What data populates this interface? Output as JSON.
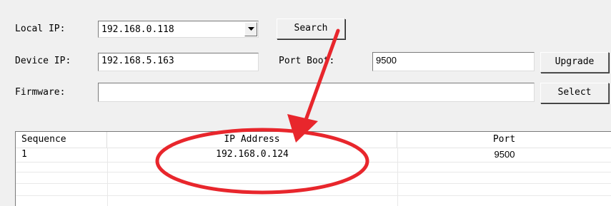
{
  "form": {
    "local_ip_label": "Local IP:",
    "local_ip_value": "192.168.0.118",
    "search_label": "Search",
    "device_ip_label": "Device IP:",
    "device_ip_value": "192.168.5.163",
    "port_boot_label": "Port Boot:",
    "port_boot_value": "9500",
    "upgrade_label": "Upgrade",
    "firmware_label": "Firmware:",
    "firmware_value": "",
    "select_label": "Select"
  },
  "table": {
    "columns": [
      "Sequence",
      "IP Address",
      "Port"
    ],
    "rows": [
      {
        "sequence": "1",
        "ip": "192.168.0.124",
        "port": "9500"
      }
    ]
  },
  "annotation": {
    "color": "#e8262c"
  }
}
